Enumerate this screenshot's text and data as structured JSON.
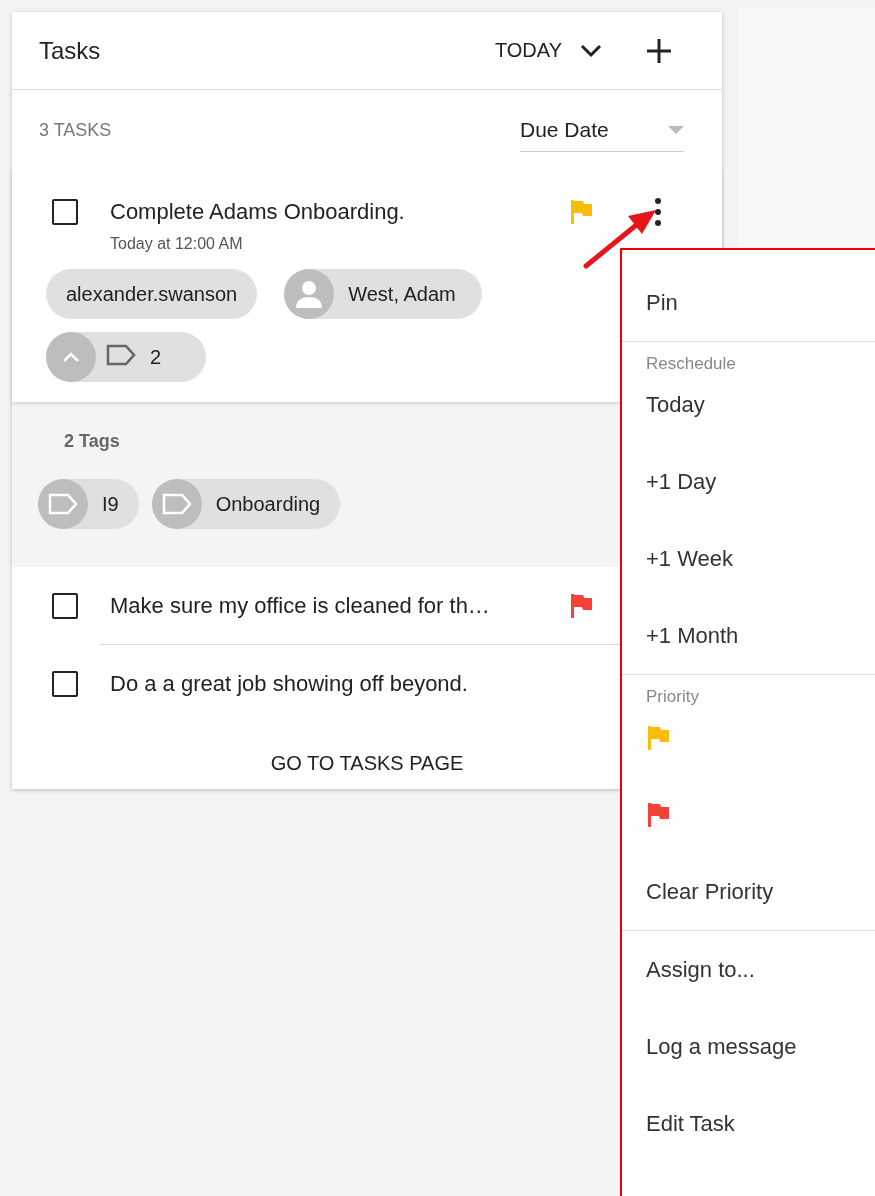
{
  "header": {
    "title": "Tasks",
    "filter": "TODAY"
  },
  "summary": {
    "count": "3 TASKS",
    "sort": "Due Date"
  },
  "tasks": [
    {
      "title": "Complete Adams Onboarding.",
      "checked": false,
      "due": "Today at 12:00 AM",
      "color": "#fbbc05",
      "owner": "alexander.swanson",
      "contact": "West, Adam",
      "tag_count": "2",
      "expanded": true,
      "tags_heading": "2 Tags",
      "tags": [
        "I9",
        "Onboarding"
      ]
    },
    {
      "title": "Make sure my office is cleaned for th…",
      "checked": false,
      "color": "#f44336"
    },
    {
      "title": "Do a a great job showing off beyond.",
      "checked": false
    }
  ],
  "footer_link": "GO TO TASKS PAGE",
  "menu": [
    {
      "kind": "item",
      "label": "Pin"
    },
    {
      "kind": "divider"
    },
    {
      "kind": "header",
      "label": "Reschedule"
    },
    {
      "kind": "item",
      "label": "Today"
    },
    {
      "kind": "item",
      "label": "+1 Day"
    },
    {
      "kind": "item",
      "label": "+1 Week"
    },
    {
      "kind": "item",
      "label": "+1 Month"
    },
    {
      "kind": "divider"
    },
    {
      "kind": "header",
      "label": "Priority"
    },
    {
      "kind": "flag",
      "color": "#fbbc05"
    },
    {
      "kind": "flag",
      "color": "#f44336"
    },
    {
      "kind": "item",
      "label": "Clear Priority"
    },
    {
      "kind": "divider"
    },
    {
      "kind": "item",
      "label": "Assign to..."
    },
    {
      "kind": "item",
      "label": "Log a message"
    },
    {
      "kind": "item",
      "label": "Edit Task"
    }
  ]
}
